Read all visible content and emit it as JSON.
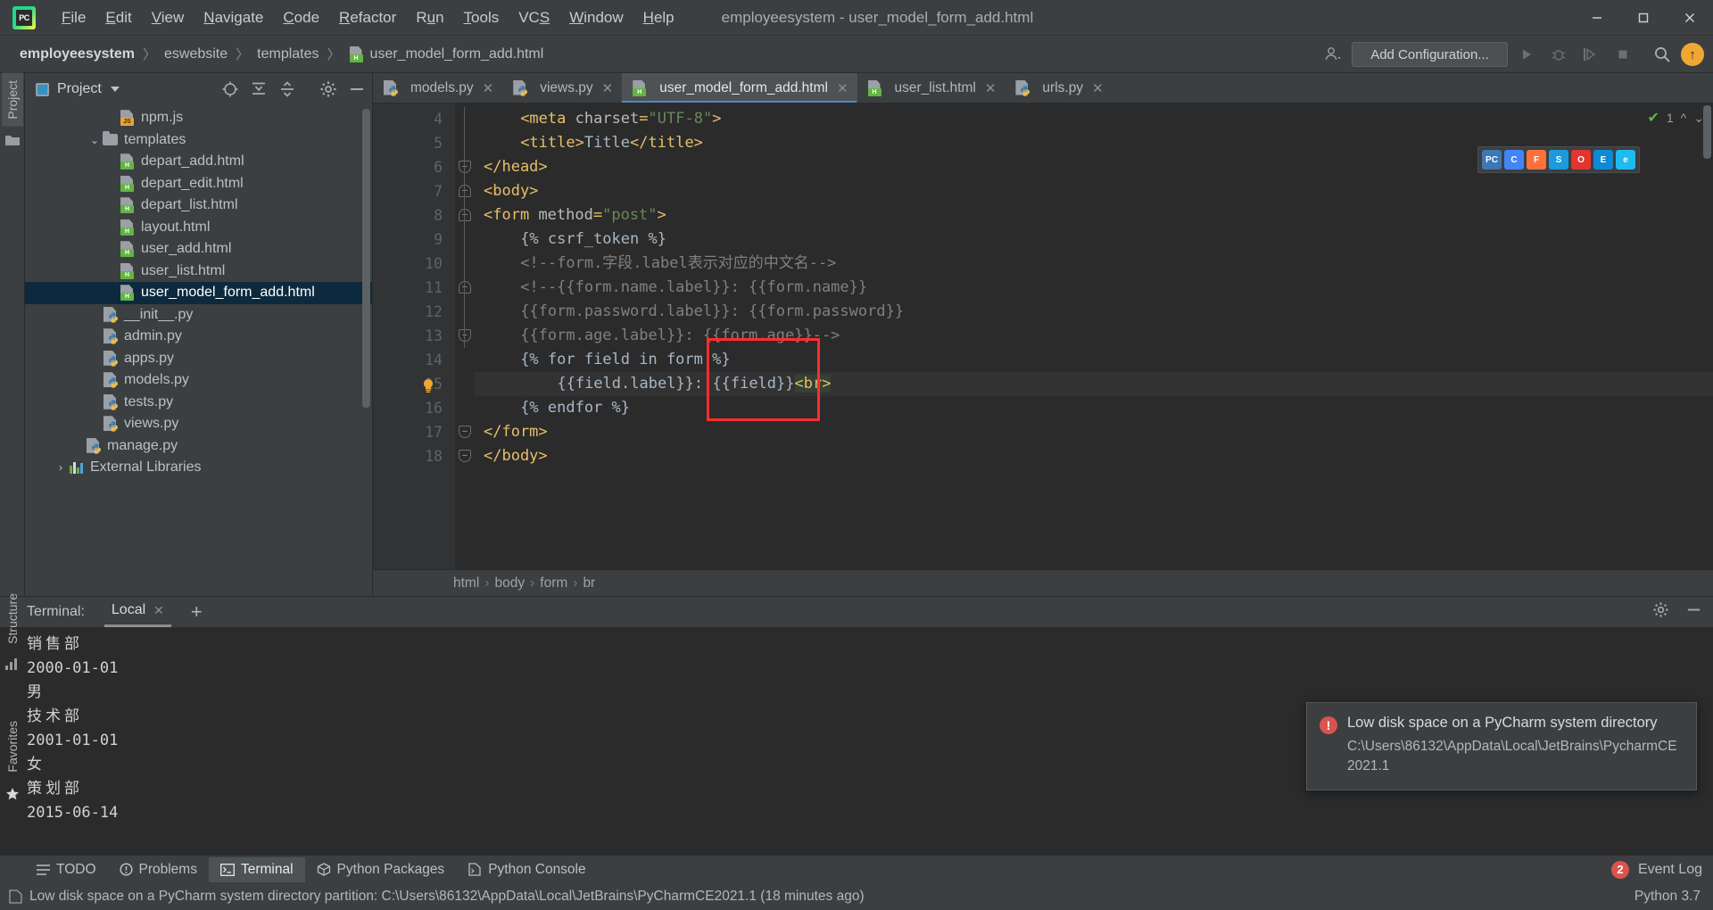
{
  "window": {
    "title": "employeesystem - user_model_form_add.html",
    "logo_text": "PC",
    "minimize": "—",
    "maximize": "❑",
    "close": "✕"
  },
  "menu": [
    {
      "label": "File",
      "mnemonic": "F"
    },
    {
      "label": "Edit",
      "mnemonic": "E"
    },
    {
      "label": "View",
      "mnemonic": "V"
    },
    {
      "label": "Navigate",
      "mnemonic": "N"
    },
    {
      "label": "Code",
      "mnemonic": "C"
    },
    {
      "label": "Refactor",
      "mnemonic": "R"
    },
    {
      "label": "Run",
      "mnemonic": "u"
    },
    {
      "label": "Tools",
      "mnemonic": "T"
    },
    {
      "label": "VCS",
      "mnemonic": "S"
    },
    {
      "label": "Window",
      "mnemonic": "W"
    },
    {
      "label": "Help",
      "mnemonic": "H"
    }
  ],
  "navbar": {
    "crumbs": [
      "employeesystem",
      "eswebsite",
      "templates",
      "user_model_form_add.html"
    ],
    "separator": "〉",
    "add_configuration": "Add Configuration...",
    "run_icon": "run-icon",
    "debug_icon": "debug-icon",
    "coverage_icon": "coverage-icon",
    "stop_icon": "stop-icon",
    "search_icon": "search-icon",
    "update_badge": "↑"
  },
  "left_strip": {
    "project_tab": "Project",
    "structure_tab": "Structure",
    "favorites_tab": "Favorites"
  },
  "project": {
    "title": "Project",
    "icons": [
      "target-icon",
      "collapse-all-icon",
      "expand-icon",
      "gear-icon",
      "hide-icon"
    ],
    "tree": [
      {
        "label": "npm.js",
        "indent": 4,
        "icon": "js",
        "twist": "",
        "selected": false
      },
      {
        "label": "templates",
        "indent": 3,
        "icon": "folder",
        "twist": "⌄",
        "selected": false
      },
      {
        "label": "depart_add.html",
        "indent": 4,
        "icon": "html",
        "twist": "",
        "selected": false
      },
      {
        "label": "depart_edit.html",
        "indent": 4,
        "icon": "html",
        "twist": "",
        "selected": false
      },
      {
        "label": "depart_list.html",
        "indent": 4,
        "icon": "html",
        "twist": "",
        "selected": false
      },
      {
        "label": "layout.html",
        "indent": 4,
        "icon": "html",
        "twist": "",
        "selected": false
      },
      {
        "label": "user_add.html",
        "indent": 4,
        "icon": "html",
        "twist": "",
        "selected": false
      },
      {
        "label": "user_list.html",
        "indent": 4,
        "icon": "html",
        "twist": "",
        "selected": false
      },
      {
        "label": "user_model_form_add.html",
        "indent": 4,
        "icon": "html",
        "twist": "",
        "selected": true
      },
      {
        "label": "__init__.py",
        "indent": 3,
        "icon": "py",
        "twist": "",
        "selected": false
      },
      {
        "label": "admin.py",
        "indent": 3,
        "icon": "py",
        "twist": "",
        "selected": false
      },
      {
        "label": "apps.py",
        "indent": 3,
        "icon": "py",
        "twist": "",
        "selected": false
      },
      {
        "label": "models.py",
        "indent": 3,
        "icon": "py",
        "twist": "",
        "selected": false
      },
      {
        "label": "tests.py",
        "indent": 3,
        "icon": "py",
        "twist": "",
        "selected": false
      },
      {
        "label": "views.py",
        "indent": 3,
        "icon": "py",
        "twist": "",
        "selected": false
      },
      {
        "label": "manage.py",
        "indent": 2,
        "icon": "py",
        "twist": "",
        "selected": false
      },
      {
        "label": "External Libraries",
        "indent": 1,
        "icon": "lib",
        "twist": "›",
        "selected": false
      }
    ]
  },
  "editor": {
    "tabs": [
      {
        "label": "models.py",
        "icon": "py",
        "active": false
      },
      {
        "label": "views.py",
        "icon": "py",
        "active": false
      },
      {
        "label": "user_model_form_add.html",
        "icon": "html",
        "active": true
      },
      {
        "label": "user_list.html",
        "icon": "html",
        "active": false
      },
      {
        "label": "urls.py",
        "icon": "py",
        "active": false
      }
    ],
    "inspection_count": "1",
    "first_line_number": 4,
    "lines": [
      {
        "n": 4,
        "indent": 4,
        "parts": [
          {
            "t": "tag",
            "s": "<meta"
          },
          {
            "t": "sp",
            "s": " "
          },
          {
            "t": "attr",
            "s": "charset"
          },
          {
            "t": "tag",
            "s": "="
          },
          {
            "t": "val",
            "s": "\"UTF-8\""
          },
          {
            "t": "tag",
            "s": ">"
          }
        ]
      },
      {
        "n": 5,
        "indent": 4,
        "parts": [
          {
            "t": "tag",
            "s": "<title>"
          },
          {
            "t": "txt",
            "s": "Title"
          },
          {
            "t": "tag",
            "s": "</title>"
          }
        ]
      },
      {
        "n": 6,
        "indent": 0,
        "parts": [
          {
            "t": "tag",
            "s": "</head>"
          }
        ]
      },
      {
        "n": 7,
        "indent": 0,
        "parts": [
          {
            "t": "tag",
            "s": "<body>"
          }
        ]
      },
      {
        "n": 8,
        "indent": 0,
        "parts": [
          {
            "t": "tag",
            "s": "<form"
          },
          {
            "t": "sp",
            "s": " "
          },
          {
            "t": "attr",
            "s": "method"
          },
          {
            "t": "tag",
            "s": "="
          },
          {
            "t": "val",
            "s": "\"post\""
          },
          {
            "t": "tag",
            "s": ">"
          }
        ]
      },
      {
        "n": 9,
        "indent": 4,
        "parts": [
          {
            "t": "tmpl",
            "s": "{% csrf_token %}"
          }
        ]
      },
      {
        "n": 10,
        "indent": 4,
        "parts": [
          {
            "t": "cmt",
            "s": "<!--form.字段.label表示对应的中文名-->"
          }
        ]
      },
      {
        "n": 11,
        "indent": 4,
        "parts": [
          {
            "t": "cmt",
            "s": "<!--{{form.name.label}}: {{form.name}}"
          }
        ]
      },
      {
        "n": 12,
        "indent": 4,
        "parts": [
          {
            "t": "cmt",
            "s": "{{form.password.label}}: {{form.password}}"
          }
        ]
      },
      {
        "n": 13,
        "indent": 4,
        "parts": [
          {
            "t": "cmt",
            "s": "{{form.age.label}}: {{form.age}}-->"
          }
        ]
      },
      {
        "n": 14,
        "indent": 4,
        "parts": [
          {
            "t": "tmpl",
            "s": "{% for field in form %}"
          }
        ]
      },
      {
        "n": 15,
        "indent": 8,
        "current": true,
        "bulb": true,
        "parts": [
          {
            "t": "tmpl",
            "s": "{{field.label}}: {{field}}"
          },
          {
            "t": "brhl",
            "s": "<br>"
          }
        ]
      },
      {
        "n": 16,
        "indent": 4,
        "parts": [
          {
            "t": "tmpl",
            "s": "{% endfor %}"
          }
        ]
      },
      {
        "n": 17,
        "indent": 0,
        "parts": [
          {
            "t": "tag",
            "s": "</form>"
          }
        ]
      },
      {
        "n": 18,
        "indent": 0,
        "parts": [
          {
            "t": "tag",
            "s": "</body>"
          }
        ]
      }
    ],
    "breadcrumbs": [
      "html",
      "body",
      "form",
      "br"
    ],
    "breadcrumb_sep": "›",
    "browsers": [
      {
        "name": "pycharm-browser-icon",
        "color": "#3c78b4",
        "glyph": "PC"
      },
      {
        "name": "chrome-browser-icon",
        "color": "#4285f4",
        "glyph": "C"
      },
      {
        "name": "firefox-browser-icon",
        "color": "#ff7139",
        "glyph": "F"
      },
      {
        "name": "safari-browser-icon",
        "color": "#1c9bdc",
        "glyph": "S"
      },
      {
        "name": "opera-browser-icon",
        "color": "#e3342f",
        "glyph": "O"
      },
      {
        "name": "edge-browser-icon",
        "color": "#0e8ad4",
        "glyph": "E"
      },
      {
        "name": "ie-browser-icon",
        "color": "#1ebbee",
        "glyph": "e"
      }
    ]
  },
  "terminal": {
    "label": "Terminal:",
    "tab": "Local",
    "close_glyph": "✕",
    "plus_glyph": "+",
    "gear_icon": "gear-icon",
    "hide_icon": "hide-icon",
    "output": [
      "销售部",
      "2000-01-01",
      "男",
      "技术部",
      "2001-01-01",
      "女",
      "策划部",
      "2015-06-14"
    ]
  },
  "notification": {
    "icon": "error-icon",
    "icon_glyph": "!",
    "title": "Low disk space on a PyCharm system directory",
    "body": "C:\\Users\\86132\\AppData\\Local\\JetBrains\\PycharmCE2021.1"
  },
  "bottom_tools": [
    {
      "label": "TODO",
      "icon": "todo-icon",
      "active": false
    },
    {
      "label": "Problems",
      "icon": "problems-icon",
      "active": false
    },
    {
      "label": "Terminal",
      "icon": "terminal-icon",
      "active": true
    },
    {
      "label": "Python Packages",
      "icon": "packages-icon",
      "active": false
    },
    {
      "label": "Python Console",
      "icon": "console-icon",
      "active": false
    }
  ],
  "bottom_right": {
    "event_count": "2",
    "event_log": "Event Log"
  },
  "statusbar": {
    "message": "Low disk space on a PyCharm system directory partition: C:\\Users\\86132\\AppData\\Local\\JetBrains\\PyCharmCE2021.1 (18 minutes ago)",
    "interpreter": "Python 3.7"
  }
}
